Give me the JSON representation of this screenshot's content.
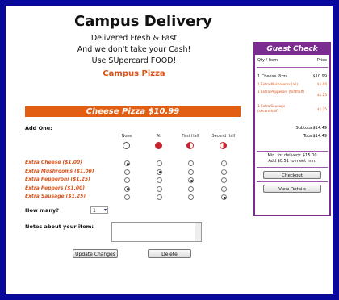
{
  "header": {
    "title": "Campus Delivery",
    "tagline1": "Delivered Fresh & Fast",
    "tagline2": "And we don't take your Cash!",
    "tagline3": "Use SUpercard FOOD!",
    "brand": "Campus Pizza"
  },
  "item": {
    "banner": "Cheese Pizza $10.99",
    "add_one_label": "Add One:",
    "columns": [
      "None",
      "All",
      "First Half",
      "Second Half"
    ],
    "toppings": [
      {
        "label": "Extra Cheese  ($1.00)",
        "selected": 0
      },
      {
        "label": "Extra Mushrooms  ($1.00)",
        "selected": 1
      },
      {
        "label": "Extra Pepperoni  ($1.25)",
        "selected": 2
      },
      {
        "label": "Extra Peppers  ($1.00)",
        "selected": 0
      },
      {
        "label": "Extra Sausage  ($1.25)",
        "selected": 3
      }
    ],
    "how_many_label": "How many?",
    "quantity": "1",
    "notes_label": "Notes about your item:",
    "notes_value": "",
    "update_button": "Update Changes",
    "delete_button": "Delete"
  },
  "guest_check": {
    "title": "Guest Check",
    "col_item": "Qty / Item",
    "col_price": "Price",
    "line_item": "1 Cheese Pizza",
    "line_price": "$10.99",
    "extras": [
      {
        "text": "1 Extra Mushrooms (all)",
        "price": "$1.00"
      },
      {
        "text": "1 Extra Pepperoni (firsthalf)",
        "price": "$1.25"
      },
      {
        "text": "1 Extra Sausage (secondhalf)",
        "price": "$1.25"
      }
    ],
    "subtotal_label": "Subtotal",
    "subtotal": "$14.49",
    "total_label": "Total",
    "total": "$14.49",
    "min_note1": "Min. for delivery: $15.00",
    "min_note2": "Add $0.51 to meet min.",
    "checkout_button": "Checkout",
    "details_button": "View Details"
  }
}
